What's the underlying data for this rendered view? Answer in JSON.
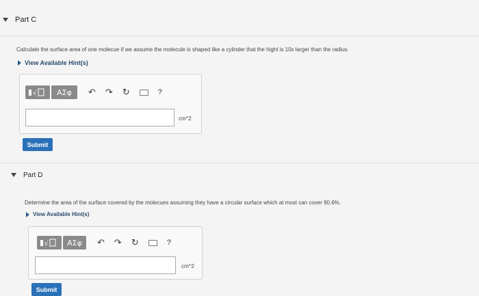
{
  "parts": [
    {
      "title": "Part C",
      "prompt": "Calculate the surface area of one molecue if we assume the molecule is shaped like a cylinder that the hight is 10x larger than the radius.",
      "hint_label": "View Available Hint(s)",
      "toolbar": {
        "templates_icon": "templates-icon",
        "greek_label": "ΑΣφ",
        "undo_icon": "undo-icon",
        "redo_icon": "redo-icon",
        "reset_icon": "reset-icon",
        "keyboard_icon": "keyboard-icon",
        "help_label": "?"
      },
      "answer_value": "",
      "unit": "cm^2",
      "submit_label": "Submit"
    },
    {
      "title": "Part D",
      "prompt": "Determine the area of the surface covered by the molecues assuming they have a circular surface which at most can cover 90.6%.",
      "hint_label": "View Available Hint(s)",
      "toolbar": {
        "templates_icon": "templates-icon",
        "greek_label": "ΑΣφ",
        "undo_icon": "undo-icon",
        "redo_icon": "redo-icon",
        "reset_icon": "reset-icon",
        "keyboard_icon": "keyboard-icon",
        "help_label": "?"
      },
      "answer_value": "",
      "unit": "cm^2",
      "submit_label": "Submit"
    }
  ],
  "colors": {
    "submit": "#2a71b8",
    "hint_link": "#2c4a6e",
    "toolbar_button": "#8a8a8a"
  }
}
